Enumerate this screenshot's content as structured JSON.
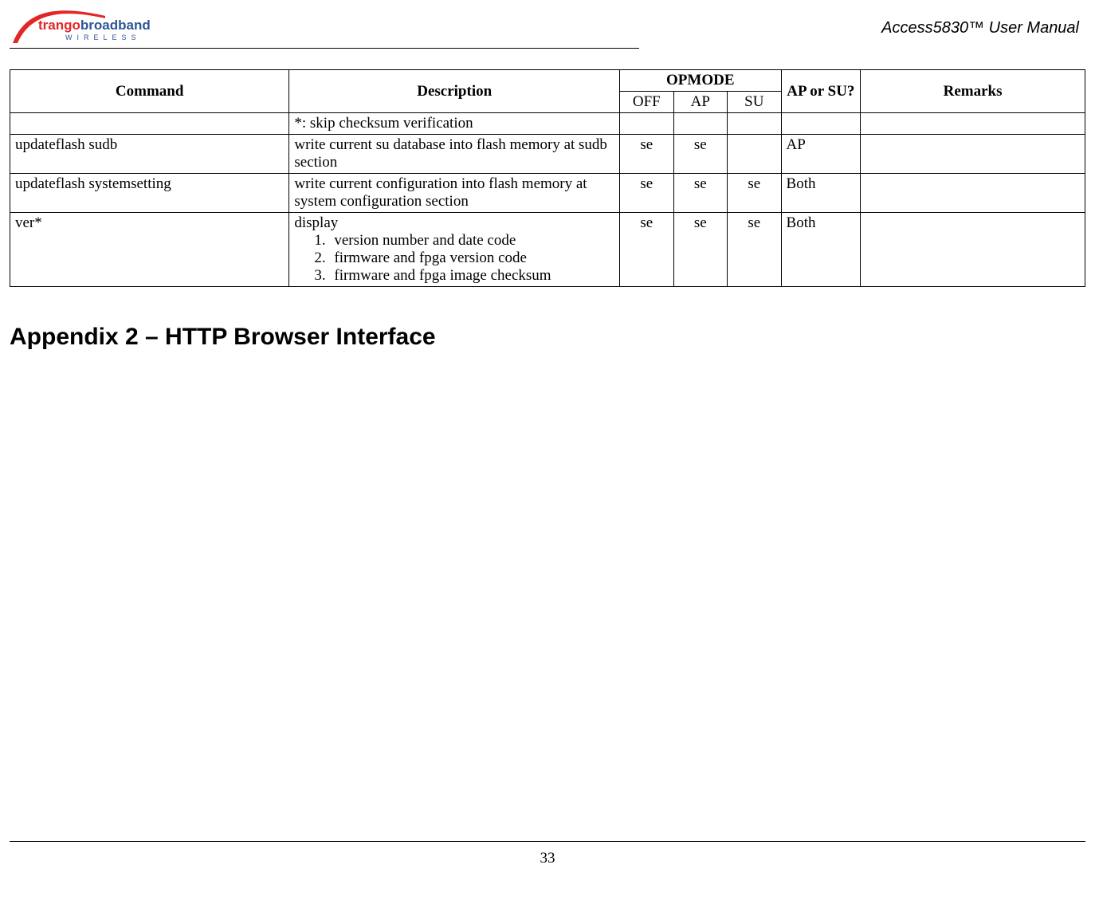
{
  "header": {
    "logo_brand_1": "trango",
    "logo_brand_2": "broadband",
    "logo_sub": "WIRELESS",
    "doc_title": "Access5830™ User Manual"
  },
  "table": {
    "headers": {
      "command": "Command",
      "description": "Description",
      "opmode": "OPMODE",
      "off": "OFF",
      "ap": "AP",
      "su": "SU",
      "ap_or_su": "AP or SU?",
      "remarks": "Remarks"
    },
    "rows": [
      {
        "command": "",
        "description": "*: skip checksum verification",
        "off": "",
        "ap": "",
        "su": "",
        "ap_or_su": "",
        "remarks": ""
      },
      {
        "command": "updateflash sudb",
        "description": "write current su database into flash memory at sudb section",
        "off": "se",
        "ap": "se",
        "su": "",
        "ap_or_su": "AP",
        "remarks": ""
      },
      {
        "command": "updateflash systemsetting",
        "description": "write current configuration into flash memory at system configuration section",
        "off": "se",
        "ap": "se",
        "su": "se",
        "ap_or_su": "Both",
        "remarks": ""
      },
      {
        "command": "ver*",
        "description_lead": "display",
        "description_list": [
          "version number and date code",
          "firmware and fpga version code",
          "firmware and fpga image checksum"
        ],
        "off": "se",
        "ap": "se",
        "su": "se",
        "ap_or_su": "Both",
        "remarks": ""
      }
    ]
  },
  "appendix_title": "Appendix 2 – HTTP Browser Interface",
  "page_number": "33"
}
